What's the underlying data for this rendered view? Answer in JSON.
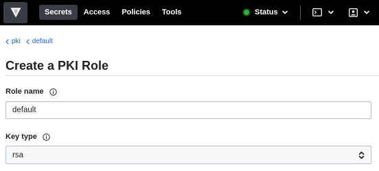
{
  "nav": {
    "links": [
      "Secrets",
      "Access",
      "Policies",
      "Tools"
    ],
    "active": "Secrets",
    "status_label": "Status",
    "status_color": "#2eb039"
  },
  "breadcrumb": [
    "pki",
    "default"
  ],
  "page_title": "Create a PKI Role",
  "form": {
    "role_name_label": "Role name",
    "role_name_value": "default",
    "key_type_label": "Key type",
    "key_type_value": "rsa"
  },
  "colors": {
    "nav_bg": "#000000",
    "active_tab_bg": "#3b3d45",
    "link_blue": "#1563ff"
  },
  "icons": [
    "vault-logo-icon",
    "chevron-down-icon",
    "console-icon",
    "user-icon",
    "chevron-left-icon",
    "info-icon",
    "select-arrows-icon"
  ]
}
